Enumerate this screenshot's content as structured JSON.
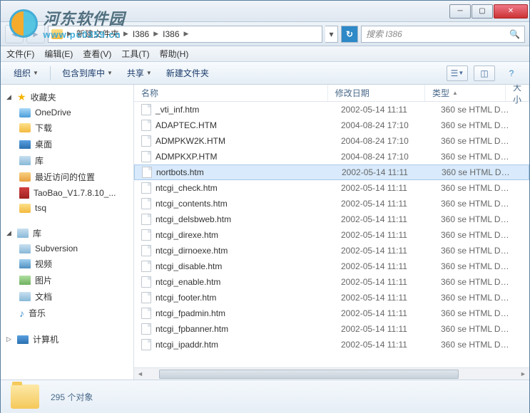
{
  "watermark": {
    "cn": "河东软件园",
    "en": "www.pc0359.cn"
  },
  "breadcrumb": {
    "items": [
      "新建文件夹",
      "I386",
      "I386"
    ]
  },
  "search": {
    "placeholder": "搜索 I386"
  },
  "menu": {
    "file": "文件(F)",
    "edit": "编辑(E)",
    "view": "查看(V)",
    "tools": "工具(T)",
    "help": "帮助(H)"
  },
  "toolbar": {
    "organize": "组织",
    "include": "包含到库中",
    "share": "共享",
    "newfolder": "新建文件夹"
  },
  "sidebar": {
    "favorites": {
      "label": "收藏夹",
      "items": [
        {
          "icon": "cloud",
          "label": "OneDrive"
        },
        {
          "icon": "folder-dl",
          "label": "下载"
        },
        {
          "icon": "desktop",
          "label": "桌面"
        },
        {
          "icon": "libraries",
          "label": "库"
        },
        {
          "icon": "recent",
          "label": "最近访问的位置"
        },
        {
          "icon": "zip",
          "label": "TaoBao_V1.7.8.10_..."
        },
        {
          "icon": "folder",
          "label": "tsq"
        }
      ]
    },
    "libraries": {
      "label": "库",
      "items": [
        {
          "icon": "svn",
          "label": "Subversion"
        },
        {
          "icon": "video",
          "label": "视频"
        },
        {
          "icon": "pic",
          "label": "图片"
        },
        {
          "icon": "doc",
          "label": "文档"
        },
        {
          "icon": "music",
          "label": "音乐"
        }
      ]
    },
    "computer": {
      "label": "计算机"
    }
  },
  "columns": {
    "name": "名称",
    "date": "修改日期",
    "type": "类型",
    "size": "大小"
  },
  "files": [
    {
      "name": "_vti_inf.htm",
      "date": "2002-05-14 11:11",
      "type": "360 se HTML Do...",
      "sel": false
    },
    {
      "name": "ADAPTEC.HTM",
      "date": "2004-08-24 17:10",
      "type": "360 se HTML Do...",
      "sel": false
    },
    {
      "name": "ADMPKW2K.HTM",
      "date": "2004-08-24 17:10",
      "type": "360 se HTML Do...",
      "sel": false
    },
    {
      "name": "ADMPKXP.HTM",
      "date": "2004-08-24 17:10",
      "type": "360 se HTML Do...",
      "sel": false
    },
    {
      "name": "nortbots.htm",
      "date": "2002-05-14 11:11",
      "type": "360 se HTML Do...",
      "sel": true
    },
    {
      "name": "ntcgi_check.htm",
      "date": "2002-05-14 11:11",
      "type": "360 se HTML Do...",
      "sel": false
    },
    {
      "name": "ntcgi_contents.htm",
      "date": "2002-05-14 11:11",
      "type": "360 se HTML Do...",
      "sel": false
    },
    {
      "name": "ntcgi_delsbweb.htm",
      "date": "2002-05-14 11:11",
      "type": "360 se HTML Do...",
      "sel": false
    },
    {
      "name": "ntcgi_direxe.htm",
      "date": "2002-05-14 11:11",
      "type": "360 se HTML Do...",
      "sel": false
    },
    {
      "name": "ntcgi_dirnoexe.htm",
      "date": "2002-05-14 11:11",
      "type": "360 se HTML Do...",
      "sel": false
    },
    {
      "name": "ntcgi_disable.htm",
      "date": "2002-05-14 11:11",
      "type": "360 se HTML Do...",
      "sel": false
    },
    {
      "name": "ntcgi_enable.htm",
      "date": "2002-05-14 11:11",
      "type": "360 se HTML Do...",
      "sel": false
    },
    {
      "name": "ntcgi_footer.htm",
      "date": "2002-05-14 11:11",
      "type": "360 se HTML Do...",
      "sel": false
    },
    {
      "name": "ntcgi_fpadmin.htm",
      "date": "2002-05-14 11:11",
      "type": "360 se HTML Do...",
      "sel": false
    },
    {
      "name": "ntcgi_fpbanner.htm",
      "date": "2002-05-14 11:11",
      "type": "360 se HTML Do...",
      "sel": false
    },
    {
      "name": "ntcgi_ipaddr.htm",
      "date": "2002-05-14 11:11",
      "type": "360 se HTML Do...",
      "sel": false
    }
  ],
  "status": {
    "count": "295 个对象"
  }
}
